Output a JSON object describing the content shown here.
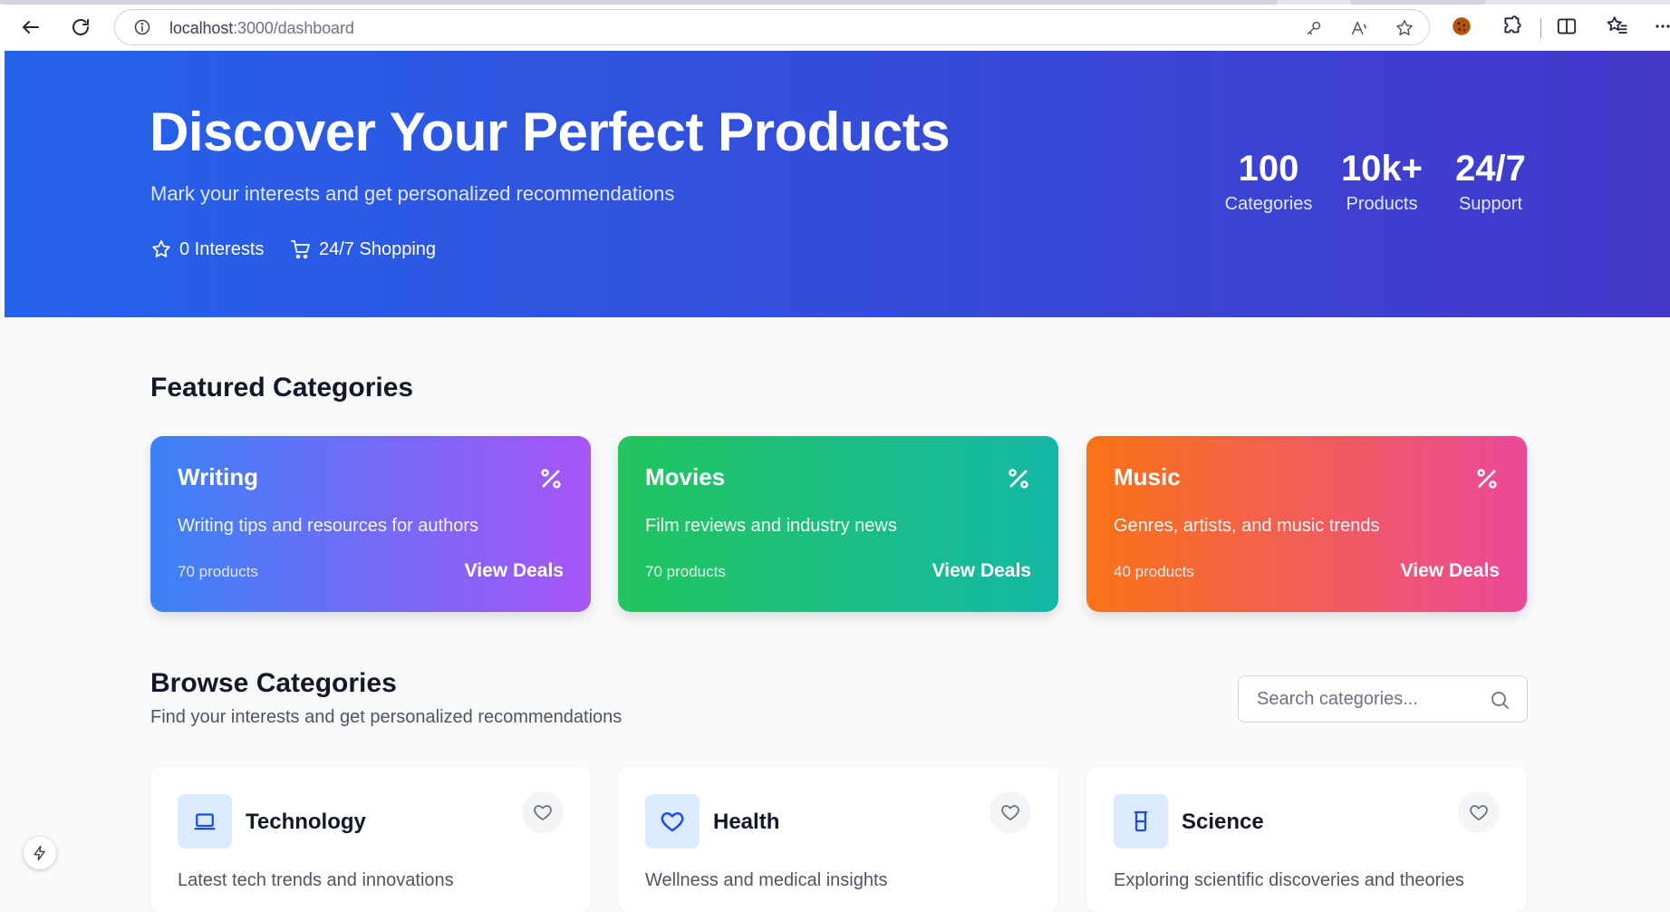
{
  "browser": {
    "url_host": "localhost",
    "url_path": ":3000/dashboard"
  },
  "hero": {
    "title": "Discover Your Perfect Products",
    "subtitle": "Mark your interests and get personalized recommendations",
    "interests_label": "0 Interests",
    "shopping_label": "24/7 Shopping",
    "stats": [
      {
        "value": "100",
        "label": "Categories"
      },
      {
        "value": "10k+",
        "label": "Products"
      },
      {
        "value": "24/7",
        "label": "Support"
      }
    ],
    "colors": {
      "start": "#2563eb",
      "end": "#4338ca"
    }
  },
  "featured": {
    "heading": "Featured Categories",
    "cards": [
      {
        "title": "Writing",
        "description": "Writing tips and resources for authors",
        "count": "70 products",
        "cta": "View Deals",
        "colors": [
          "#3b82f6",
          "#a855f7"
        ],
        "icon": "percent-icon"
      },
      {
        "title": "Movies",
        "description": "Film reviews and industry news",
        "count": "70 products",
        "cta": "View Deals",
        "colors": [
          "#22c55e",
          "#14b8a6"
        ],
        "icon": "percent-icon"
      },
      {
        "title": "Music",
        "description": "Genres, artists, and music trends",
        "count": "40 products",
        "cta": "View Deals",
        "colors": [
          "#f97316",
          "#ec4899"
        ],
        "icon": "percent-icon"
      }
    ]
  },
  "browse": {
    "heading": "Browse Categories",
    "subtitle": "Find your interests and get personalized recommendations",
    "search_placeholder": "Search categories...",
    "cards": [
      {
        "title": "Technology",
        "description": "Latest tech trends and innovations",
        "icon": "laptop-icon"
      },
      {
        "title": "Health",
        "description": "Wellness and medical insights",
        "icon": "heart-icon"
      },
      {
        "title": "Science",
        "description": "Exploring scientific discoveries and theories",
        "icon": "beaker-icon"
      }
    ]
  }
}
